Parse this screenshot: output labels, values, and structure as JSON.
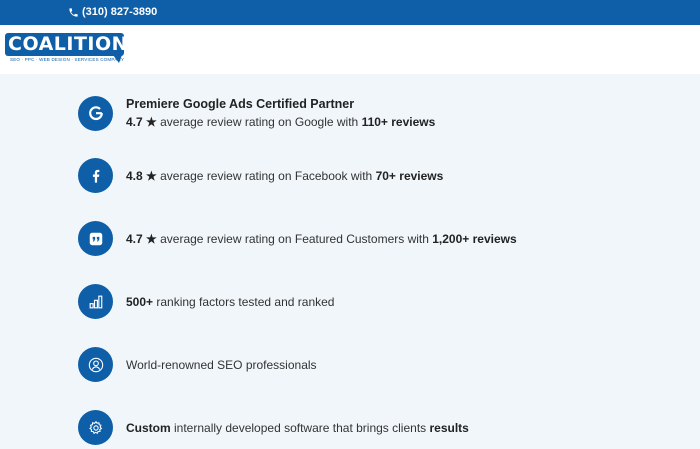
{
  "topbar": {
    "phone": "(310) 827-3890"
  },
  "logo": {
    "wordmark": "COALITION",
    "tagline": "SEO · PPC · WEB DESIGN · SERVICES COMPANY"
  },
  "features": [
    {
      "icon": "google-icon",
      "title": "Premiere Google Ads Certified Partner",
      "bold1": "4.7 ★",
      "middle": " average review rating on Google with ",
      "bold2": "110+ reviews",
      "tail": ""
    },
    {
      "icon": "facebook-icon",
      "bold1": "4.8 ★",
      "middle": " average review rating on Facebook with ",
      "bold2": "70+ reviews",
      "tail": ""
    },
    {
      "icon": "featured-customers-icon",
      "bold1": "4.7 ★",
      "middle": " average review rating on Featured Customers with ",
      "bold2": "1,200+ reviews",
      "tail": ""
    },
    {
      "icon": "bar-chart-icon",
      "bold1": "500+",
      "middle": " ranking factors tested and ranked",
      "bold2": "",
      "tail": ""
    },
    {
      "icon": "person-icon",
      "bold1": "",
      "middle": "World-renowned SEO professionals",
      "bold2": "",
      "tail": ""
    },
    {
      "icon": "gear-icon",
      "bold1": "Custom",
      "middle": " internally developed software that brings clients ",
      "bold2": "results",
      "tail": ""
    }
  ],
  "colors": {
    "brand_blue": "#0e5fa7",
    "background": "#f1f6fa",
    "header": "#ffffff"
  }
}
